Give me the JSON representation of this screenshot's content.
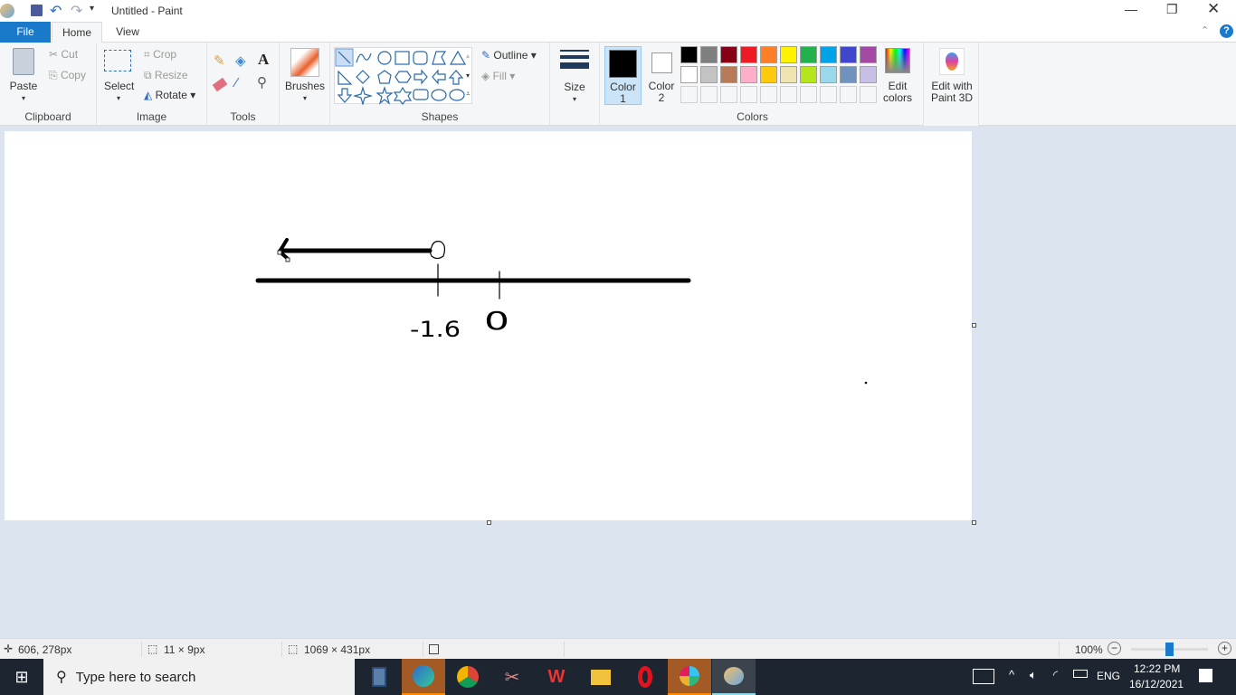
{
  "window": {
    "title": "Untitled - Paint"
  },
  "tabs": [
    {
      "label": "File"
    },
    {
      "label": "Home"
    },
    {
      "label": "View"
    }
  ],
  "ribbon": {
    "clipboard": {
      "label": "Clipboard",
      "paste": "Paste",
      "cut": "Cut",
      "copy": "Copy"
    },
    "image": {
      "label": "Image",
      "select": "Select",
      "crop": "Crop",
      "resize": "Resize",
      "rotate": "Rotate"
    },
    "tools": {
      "label": "Tools"
    },
    "brushes": {
      "label": "Brushes"
    },
    "shapes": {
      "label": "Shapes",
      "outline": "Outline",
      "fill": "Fill"
    },
    "size": {
      "label": "Size"
    },
    "colors": {
      "label": "Colors",
      "color1": "Color",
      "color1_num": "1",
      "color2": "Color",
      "color2_num": "2",
      "edit_colors": "Edit",
      "edit_colors2": "colors",
      "color1_value": "#000000",
      "color2_value": "#ffffff",
      "palette_row1": [
        "#000000",
        "#7f7f7f",
        "#880015",
        "#ed1c24",
        "#ff7f27",
        "#fff200",
        "#22b14c",
        "#00a2e8",
        "#3f48cc",
        "#a349a4"
      ],
      "palette_row2": [
        "#ffffff",
        "#c3c3c3",
        "#b97a57",
        "#ffaec9",
        "#ffc90e",
        "#efe4b0",
        "#b5e61d",
        "#99d9ea",
        "#7092be",
        "#c8bfe7"
      ]
    },
    "paint3d": {
      "line1": "Edit with",
      "line2": "Paint 3D"
    }
  },
  "canvas_drawing": {
    "handwritten_labels": [
      "-1.6",
      "0"
    ]
  },
  "status": {
    "cursor": "606, 278px",
    "selection": "11 × 9px",
    "canvas_size": "1069 × 431px",
    "zoom": "100%",
    "zoom_fraction": 0.5
  },
  "taskbar": {
    "search_placeholder": "Type here to search",
    "lang": "ENG",
    "time": "12:22 PM",
    "date": "16/12/2021"
  }
}
